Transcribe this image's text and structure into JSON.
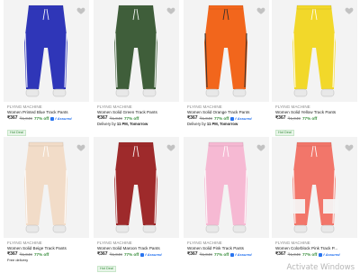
{
  "row1": [
    {
      "brand": "FLYING MACHINE",
      "title": "Women Printed Blue Track Pants",
      "price": "₹367",
      "mrp": "₹1,049",
      "off": "77% off",
      "assured": "f Assured",
      "tag": "Hot Deal",
      "extra_label": "Size",
      "extra_value": "26, 30, 32, 34, 36",
      "pant_color": "#2f36b8",
      "stripe_color": "#ffffff"
    },
    {
      "brand": "FLYING MACHINE",
      "title": "Women Solid Green Track Pants",
      "price": "₹367",
      "mrp": "₹1,049",
      "off": "77% off",
      "assured": "",
      "tag": "",
      "extra_label": "Delivery by",
      "extra_value": "11 PM, Tomorrow",
      "pant_color": "#3f5e3a",
      "stripe_color": "#ffffff"
    },
    {
      "brand": "FLYING MACHINE",
      "title": "Women Solid Orange Track Pants",
      "price": "₹367",
      "mrp": "₹1,049",
      "off": "77% off",
      "assured": "f Assured",
      "tag": "",
      "extra_label": "Delivery by",
      "extra_value": "11 PM, Tomorrow",
      "pant_color": "#f2661c",
      "stripe_color": "#2b2b2b"
    },
    {
      "brand": "FLYING MACHINE",
      "title": "Women Solid Yellow Track Pants",
      "price": "₹367",
      "mrp": "₹1,049",
      "off": "77% off",
      "assured": "",
      "tag": "Hot Deal",
      "extra_label": "",
      "extra_value": "",
      "pant_color": "#f2d82a",
      "stripe_color": "#ffffff"
    }
  ],
  "row2": [
    {
      "brand": "FLYING MACHINE",
      "title": "Women Solid Beige Track Pants",
      "price": "₹367",
      "mrp": "₹1,049",
      "off": "77% off",
      "assured": "",
      "tag": "",
      "extra_label": "Free delivery",
      "extra_value": "",
      "pant_color": "#f2dcc8",
      "stripe_color": "#ffffff"
    },
    {
      "brand": "FLYING MACHINE",
      "title": "Women Solid Maroon Track Pants",
      "price": "₹367",
      "mrp": "₹1,049",
      "off": "77% off",
      "assured": "f Assured",
      "tag": "Hot Deal",
      "extra_label": "",
      "extra_value": "",
      "pant_color": "#9e2a2b",
      "stripe_color": "#ffffff"
    },
    {
      "brand": "FLYING MACHINE",
      "title": "Women Solid Pink Track Pants",
      "price": "₹367",
      "mrp": "₹1,049",
      "off": "77% off",
      "assured": "f Assured",
      "tag": "",
      "extra_label": "",
      "extra_value": "",
      "pant_color": "#f6b9d3",
      "stripe_color": "#ffffff"
    },
    {
      "brand": "FLYING MACHINE",
      "title": "Women Colorblock Pink Track P...",
      "price": "₹367",
      "mrp": "₹1,049",
      "off": "77% off",
      "assured": "f Assured",
      "tag": "",
      "extra_label": "",
      "extra_value": "",
      "pant_color": "#f2766a",
      "stripe_color": "#ffffff"
    }
  ],
  "watermark": "Activate Windows",
  "icons": {
    "wishlist": "heart-icon",
    "assured_badge": "assured-badge-icon"
  }
}
